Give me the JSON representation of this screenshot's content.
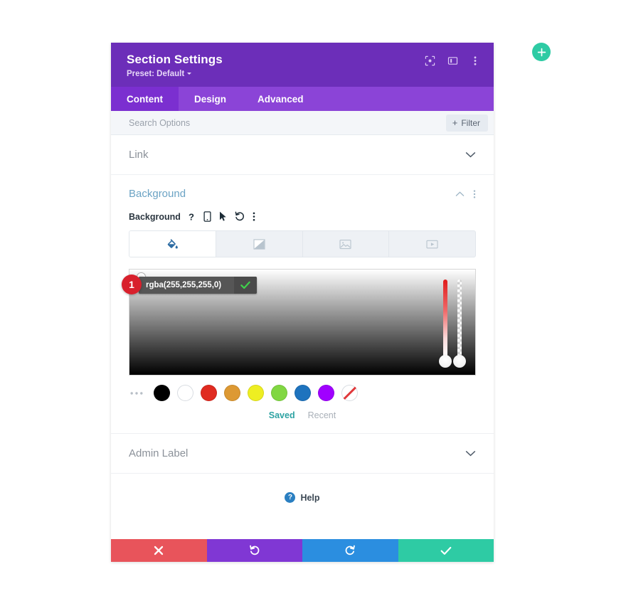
{
  "fab": {
    "name": "add-section-button",
    "label": "+",
    "color": "#2ecba4"
  },
  "header": {
    "title": "Section Settings",
    "preset": "Preset: Default",
    "bg_color": "#6c2eb9",
    "icons": [
      {
        "name": "focus-target-icon",
        "label": "Focus"
      },
      {
        "name": "layout-panel-icon",
        "label": "Layout"
      },
      {
        "name": "more-vertical-icon",
        "label": "More options"
      }
    ]
  },
  "tabs": [
    {
      "label": "Content",
      "active": true
    },
    {
      "label": "Design",
      "active": false
    },
    {
      "label": "Advanced",
      "active": false
    }
  ],
  "search": {
    "placeholder": "Search Options",
    "value": "",
    "filter_label": "Filter",
    "filter_plus": "+"
  },
  "sections": {
    "link": {
      "title": "Link",
      "expanded": false
    },
    "admin_label": {
      "title": "Admin Label",
      "expanded": false
    },
    "background": {
      "title": "Background",
      "expanded": true,
      "field_label": "Background",
      "field_icons": [
        {
          "name": "help-question-icon",
          "glyph": "?"
        },
        {
          "name": "responsive-mobile-icon",
          "glyph": "mobile"
        },
        {
          "name": "hover-cursor-icon",
          "glyph": "cursor"
        },
        {
          "name": "reset-undo-icon",
          "glyph": "undo"
        },
        {
          "name": "more-vertical-icon",
          "glyph": "dots"
        }
      ],
      "type_tabs": [
        {
          "name": "background-color-tab",
          "label": "Color",
          "active": true
        },
        {
          "name": "background-gradient-tab",
          "label": "Gradient",
          "active": false
        },
        {
          "name": "background-image-tab",
          "label": "Image",
          "active": false
        },
        {
          "name": "background-video-tab",
          "label": "Video",
          "active": false
        }
      ],
      "color_picker": {
        "value": "rgba(255,255,255,0)",
        "confirm_label": "Apply color",
        "step_badge": "1",
        "hue_slider": {
          "name": "hue-slider",
          "position_pct": 100
        },
        "alpha_slider": {
          "name": "alpha-slider",
          "position_pct": 100
        },
        "swatch_menu": "...",
        "swatches": [
          {
            "name": "swatch-black",
            "color": "#000000"
          },
          {
            "name": "swatch-white",
            "color": "#ffffff"
          },
          {
            "name": "swatch-red",
            "color": "#e02b20"
          },
          {
            "name": "swatch-orange",
            "color": "#dd9933"
          },
          {
            "name": "swatch-yellow",
            "color": "#eeee22"
          },
          {
            "name": "swatch-green",
            "color": "#81d742"
          },
          {
            "name": "swatch-blue",
            "color": "#1e73be"
          },
          {
            "name": "swatch-purple",
            "color": "#a000ff"
          },
          {
            "name": "swatch-transparent",
            "color": "transparent"
          }
        ],
        "palette_tabs": [
          {
            "label": "Saved",
            "active": true
          },
          {
            "label": "Recent",
            "active": false
          }
        ]
      }
    }
  },
  "help": {
    "label": "Help",
    "badge": "?"
  },
  "footer": [
    {
      "name": "discard-button",
      "icon": "close-icon",
      "color": "#e8545b"
    },
    {
      "name": "undo-button",
      "icon": "undo-icon",
      "color": "#8037d4"
    },
    {
      "name": "redo-button",
      "icon": "redo-icon",
      "color": "#2b8ee0"
    },
    {
      "name": "save-button",
      "icon": "check-icon",
      "color": "#2ecba4"
    }
  ]
}
